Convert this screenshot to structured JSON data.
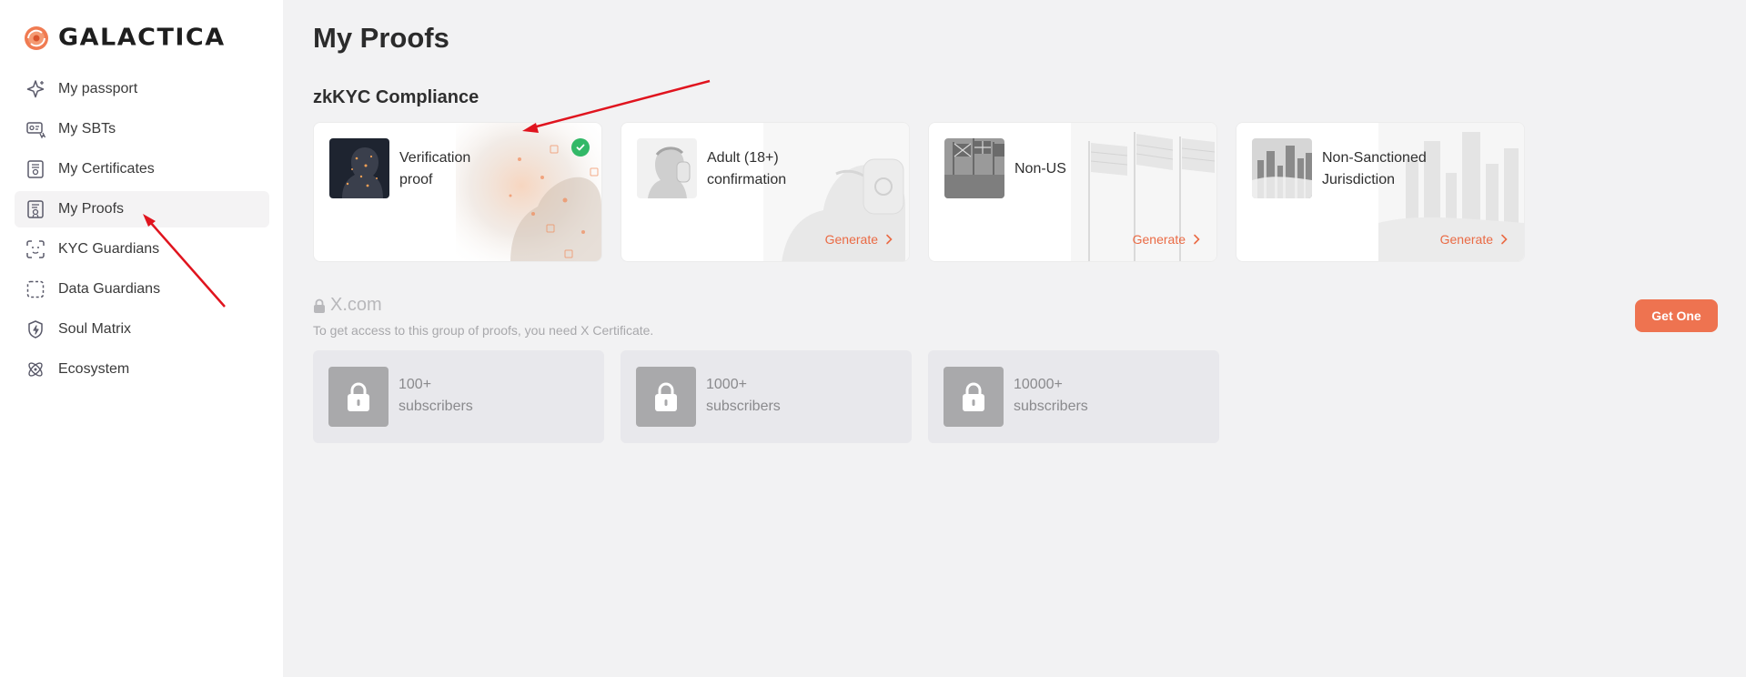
{
  "app": {
    "name": "GALACTICA"
  },
  "sidebar": {
    "items": [
      {
        "label": "My passport",
        "icon": "sparkle-icon",
        "active": false
      },
      {
        "label": "My SBTs",
        "icon": "sbt-card-icon",
        "active": false
      },
      {
        "label": "My Certificates",
        "icon": "certificate-icon",
        "active": false
      },
      {
        "label": "My Proofs",
        "icon": "proof-icon",
        "active": true
      },
      {
        "label": "KYC Guardians",
        "icon": "face-scan-icon",
        "active": false
      },
      {
        "label": "Data Guardians",
        "icon": "dashed-frame-icon",
        "active": false
      },
      {
        "label": "Soul Matrix",
        "icon": "shield-bolt-icon",
        "active": false
      },
      {
        "label": "Ecosystem",
        "icon": "atom-icon",
        "active": false
      }
    ]
  },
  "main": {
    "title": "My Proofs",
    "zkkyc": {
      "title": "zkKYC Compliance",
      "cards": [
        {
          "title": "Verification proof",
          "line1": "Verification",
          "line2": "proof",
          "verified": true
        },
        {
          "title": "Adult (18+) confirmation",
          "line1": "Adult (18+)",
          "line2": "confirmation",
          "action": "Generate"
        },
        {
          "title": "Non-US",
          "line1": "Non-US",
          "line2": "",
          "action": "Generate"
        },
        {
          "title": "Non-Sanctioned Jurisdiction",
          "line1": "Non-Sanctioned",
          "line2": "Jurisdiction",
          "action": "Generate"
        }
      ]
    },
    "xcom": {
      "title": "X.com",
      "description": "To get access to this group of proofs, you need X Certificate.",
      "button": "Get One",
      "cards": [
        {
          "line1": "100+",
          "line2": "subscribers"
        },
        {
          "line1": "1000+",
          "line2": "subscribers"
        },
        {
          "line1": "10000+",
          "line2": "subscribers"
        }
      ]
    }
  },
  "colors": {
    "accent": "#ee7350",
    "success": "#32b867",
    "annotation": "#e0141e"
  }
}
